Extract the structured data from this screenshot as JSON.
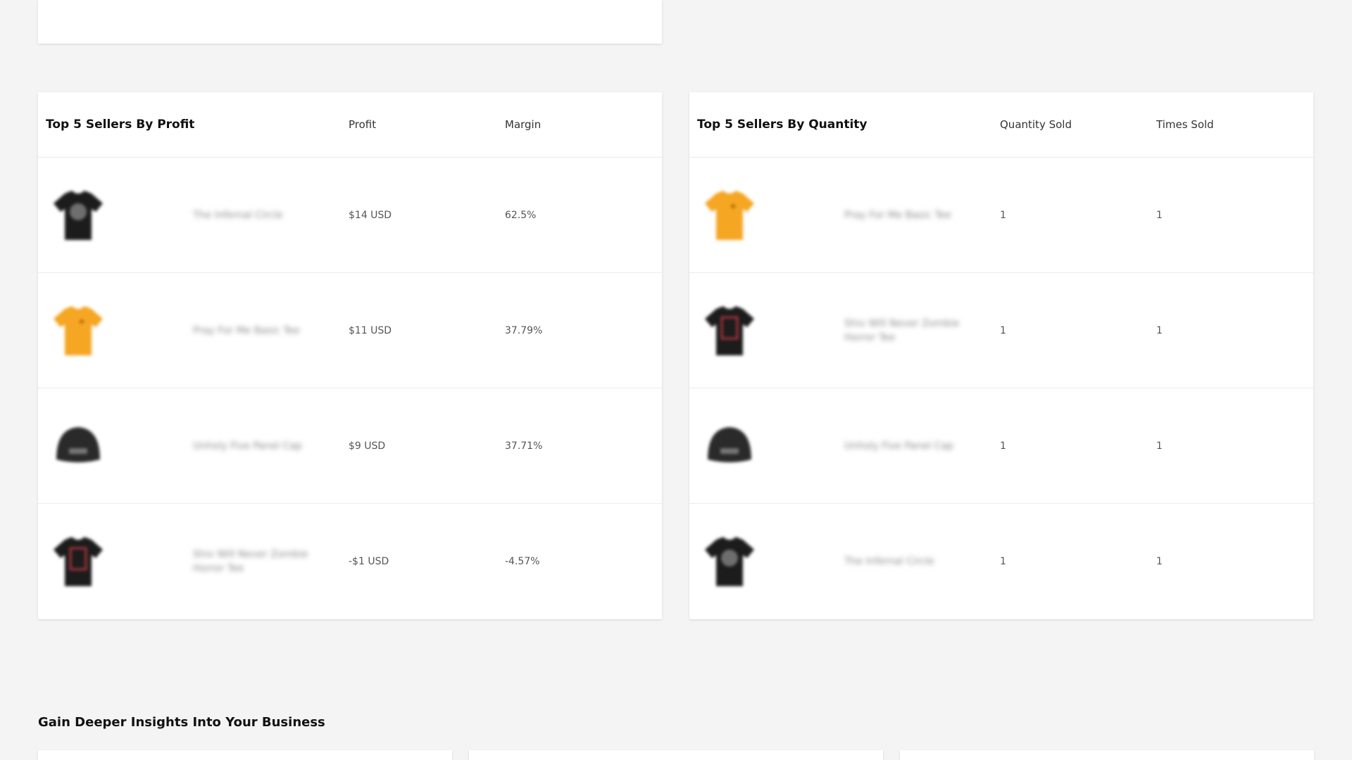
{
  "profit_table": {
    "title": "Top 5 Sellers By Profit",
    "col_profit": "Profit",
    "col_margin": "Margin",
    "rows": [
      {
        "product": "The Infernal Circle",
        "icon": "black-tshirt-icon",
        "color": "#1c1c1c",
        "profit": "$14 USD",
        "margin": "62.5%"
      },
      {
        "product": "Pray For Me Basic Tee",
        "icon": "orange-tshirt-icon",
        "color": "#f5a623",
        "profit": "$11 USD",
        "margin": "37.79%"
      },
      {
        "product": "Unholy Five Panel Cap",
        "icon": "black-cap-icon",
        "color": "#2a2a2a",
        "profit": "$9 USD",
        "margin": "37.71%"
      },
      {
        "product": "Shiv Will Never Zombie Horror Tee",
        "icon": "black-tshirt-red-print-icon",
        "color": "#1c1c1c",
        "profit": "-$1 USD",
        "margin": "-4.57%"
      }
    ]
  },
  "quantity_table": {
    "title": "Top 5 Sellers By Quantity",
    "col_qty": "Quantity Sold",
    "col_times": "Times Sold",
    "rows": [
      {
        "product": "Pray For Me Basic Tee",
        "icon": "orange-tshirt-icon",
        "color": "#f5a623",
        "qty": "1",
        "times": "1"
      },
      {
        "product": "Shiv Will Never Zombie Horror Tee",
        "icon": "black-tshirt-red-print-icon",
        "color": "#1c1c1c",
        "qty": "1",
        "times": "1"
      },
      {
        "product": "Unholy Five Panel Cap",
        "icon": "black-cap-icon",
        "color": "#2a2a2a",
        "qty": "1",
        "times": "1"
      },
      {
        "product": "The Infernal Circle",
        "icon": "black-tshirt-icon",
        "color": "#1c1c1c",
        "qty": "1",
        "times": "1"
      }
    ]
  },
  "insights": {
    "title": "Gain Deeper Insights Into Your Business"
  }
}
